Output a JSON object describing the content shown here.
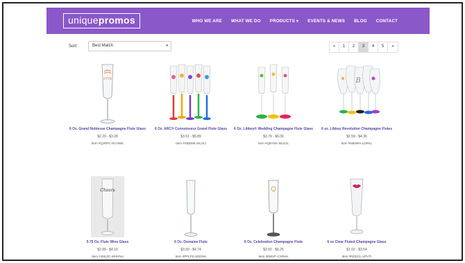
{
  "header": {
    "logo_light": "unique",
    "logo_bold": "promos",
    "nav": [
      "WHO WE ARE",
      "WHAT WE DO",
      "PRODUCTS ▾",
      "EVENTS & NEWS",
      "BLOG",
      "CONTACT"
    ]
  },
  "sort": {
    "label": "Sort:",
    "value": "Best Match",
    "caret": "▾"
  },
  "pagination": {
    "items": [
      "«",
      "1",
      "2",
      "3",
      "4",
      "5",
      "»"
    ],
    "active": "3"
  },
  "products": [
    {
      "name": "6 Oz. Grand Noblesse Champagne Flute Glass",
      "price": "$2.20 - $3.28",
      "item": "Item #QJRPC-RCHWK",
      "image": "champagne-flute-single-imprinted"
    },
    {
      "name": "6 Oz. ARC® Connoisseur Grand Flute Glass",
      "price": "$3.51 - $5.89",
      "item": "Item #XBDMK-SKJSJ",
      "image": "colored-stem-flutes-group"
    },
    {
      "name": "6 Oz. Libbey® Wedding Champagne Flute Glass",
      "price": "$3.79 - $6.06",
      "item": "Item #QBYNK-MLDJL",
      "image": "wedding-flutes-colored-bases"
    },
    {
      "name": "6 oz. Libbey Revolution Champagne Flutes",
      "price": "$2.59 - $4.36",
      "item": "Item #NBNRH-LDRKL",
      "image": "revolution-flutes-group"
    },
    {
      "name": "5.75 Oz. Flute Wine Glass",
      "price": "$2.99 - $4.19",
      "item": "Item #JMLZC-WHKNH",
      "image": "frosted-flute-script"
    },
    {
      "name": "6 Oz. Domaine Flute",
      "price": "$3.50 - $4.74",
      "item": "Item #PFLPS-SDDNH",
      "image": "plain-flute"
    },
    {
      "name": "6 Oz. Celebration Champagne Flute",
      "price": "$3.50 - $6.25",
      "item": "Item #DMVF-CXRHH",
      "image": "celebration-flute"
    },
    {
      "name": "6 oz Clear Fluted Champagne Glass",
      "price": "$1.02 - $3.54",
      "item": "Item #RDDCL-UPVTI",
      "image": "plastic-flute-lips"
    }
  ],
  "colors": {
    "header_bg": "#8a58c9",
    "product_name": "#5b3ea3"
  }
}
